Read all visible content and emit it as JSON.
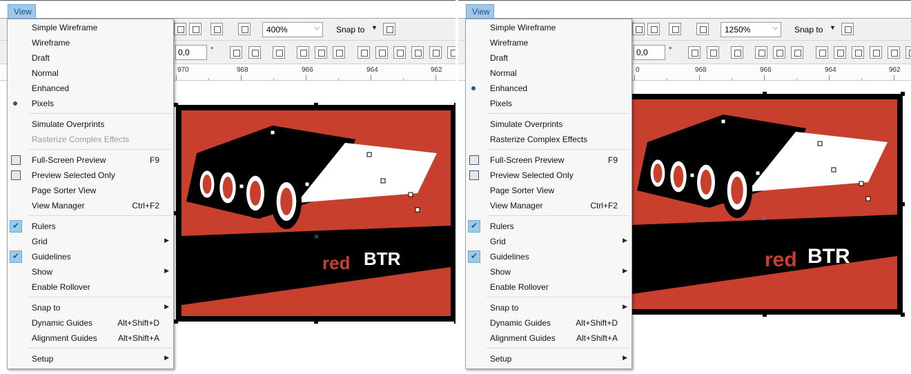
{
  "panes": [
    {
      "menubar": {
        "view_label": "View"
      },
      "toolbar": {
        "zoom": "400%",
        "snap": "Snap to",
        "field_value": "0,0"
      },
      "ruler": {
        "labels": [
          "970",
          "968",
          "966",
          "964",
          "962"
        ]
      },
      "logo": {
        "red": "red",
        "btr": "BTR"
      },
      "menu": {
        "items": [
          {
            "label": "Simple Wireframe",
            "shortcut": "",
            "state": "none",
            "icon": "",
            "enabled": true,
            "submenu": false
          },
          {
            "label": "Wireframe",
            "shortcut": "",
            "state": "none",
            "icon": "",
            "enabled": true,
            "submenu": false
          },
          {
            "label": "Draft",
            "shortcut": "",
            "state": "none",
            "icon": "",
            "enabled": true,
            "submenu": false
          },
          {
            "label": "Normal",
            "shortcut": "",
            "state": "none",
            "icon": "",
            "enabled": true,
            "submenu": false
          },
          {
            "label": "Enhanced",
            "shortcut": "",
            "state": "none",
            "icon": "",
            "enabled": true,
            "submenu": false
          },
          {
            "label": "Pixels",
            "shortcut": "",
            "state": "radio",
            "icon": "",
            "enabled": true,
            "submenu": false
          },
          {
            "label": "Simulate Overprints",
            "shortcut": "",
            "state": "none",
            "icon": "",
            "enabled": true,
            "submenu": false
          },
          {
            "label": "Rasterize Complex Effects",
            "shortcut": "",
            "state": "none",
            "icon": "",
            "enabled": false,
            "submenu": false
          },
          {
            "label": "Full-Screen Preview",
            "shortcut": "F9",
            "state": "none",
            "icon": "fullscreen-icon",
            "enabled": true,
            "submenu": false
          },
          {
            "label": "Preview Selected Only",
            "shortcut": "",
            "state": "none",
            "icon": "preview-selected-icon",
            "enabled": true,
            "submenu": false
          },
          {
            "label": "Page Sorter View",
            "shortcut": "",
            "state": "none",
            "icon": "",
            "enabled": true,
            "submenu": false
          },
          {
            "label": "View Manager",
            "shortcut": "Ctrl+F2",
            "state": "none",
            "icon": "",
            "enabled": true,
            "submenu": false
          },
          {
            "label": "Rulers",
            "shortcut": "",
            "state": "check",
            "icon": "",
            "enabled": true,
            "submenu": false
          },
          {
            "label": "Grid",
            "shortcut": "",
            "state": "none",
            "icon": "",
            "enabled": true,
            "submenu": true
          },
          {
            "label": "Guidelines",
            "shortcut": "",
            "state": "check",
            "icon": "",
            "enabled": true,
            "submenu": false
          },
          {
            "label": "Show",
            "shortcut": "",
            "state": "none",
            "icon": "",
            "enabled": true,
            "submenu": true
          },
          {
            "label": "Enable Rollover",
            "shortcut": "",
            "state": "none",
            "icon": "",
            "enabled": true,
            "submenu": false
          },
          {
            "label": "Snap to",
            "shortcut": "",
            "state": "none",
            "icon": "",
            "enabled": true,
            "submenu": true
          },
          {
            "label": "Dynamic Guides",
            "shortcut": "Alt+Shift+D",
            "state": "none",
            "icon": "",
            "enabled": true,
            "submenu": false
          },
          {
            "label": "Alignment Guides",
            "shortcut": "Alt+Shift+A",
            "state": "none",
            "icon": "",
            "enabled": true,
            "submenu": false
          },
          {
            "label": "Setup",
            "shortcut": "",
            "state": "none",
            "icon": "",
            "enabled": true,
            "submenu": true
          }
        ]
      }
    },
    {
      "menubar": {
        "view_label": "View"
      },
      "toolbar": {
        "zoom": "1250%",
        "snap": "Snap to",
        "field_value": "0,0"
      },
      "ruler": {
        "labels": [
          "0",
          "968",
          "966",
          "964",
          "962"
        ]
      },
      "logo": {
        "red": "red",
        "btr": "BTR"
      },
      "menu": {
        "items": [
          {
            "label": "Simple Wireframe",
            "shortcut": "",
            "state": "none",
            "icon": "",
            "enabled": true,
            "submenu": false
          },
          {
            "label": "Wireframe",
            "shortcut": "",
            "state": "none",
            "icon": "",
            "enabled": true,
            "submenu": false
          },
          {
            "label": "Draft",
            "shortcut": "",
            "state": "none",
            "icon": "",
            "enabled": true,
            "submenu": false
          },
          {
            "label": "Normal",
            "shortcut": "",
            "state": "none",
            "icon": "",
            "enabled": true,
            "submenu": false
          },
          {
            "label": "Enhanced",
            "shortcut": "",
            "state": "radio",
            "icon": "",
            "enabled": true,
            "submenu": false
          },
          {
            "label": "Pixels",
            "shortcut": "",
            "state": "none",
            "icon": "",
            "enabled": true,
            "submenu": false
          },
          {
            "label": "Simulate Overprints",
            "shortcut": "",
            "state": "none",
            "icon": "",
            "enabled": true,
            "submenu": false
          },
          {
            "label": "Rasterize Complex Effects",
            "shortcut": "",
            "state": "none",
            "icon": "",
            "enabled": true,
            "submenu": false
          },
          {
            "label": "Full-Screen Preview",
            "shortcut": "F9",
            "state": "none",
            "icon": "fullscreen-icon",
            "enabled": true,
            "submenu": false
          },
          {
            "label": "Preview Selected Only",
            "shortcut": "",
            "state": "none",
            "icon": "preview-selected-icon",
            "enabled": true,
            "submenu": false
          },
          {
            "label": "Page Sorter View",
            "shortcut": "",
            "state": "none",
            "icon": "",
            "enabled": true,
            "submenu": false
          },
          {
            "label": "View Manager",
            "shortcut": "Ctrl+F2",
            "state": "none",
            "icon": "",
            "enabled": true,
            "submenu": false
          },
          {
            "label": "Rulers",
            "shortcut": "",
            "state": "check",
            "icon": "",
            "enabled": true,
            "submenu": false
          },
          {
            "label": "Grid",
            "shortcut": "",
            "state": "none",
            "icon": "",
            "enabled": true,
            "submenu": true
          },
          {
            "label": "Guidelines",
            "shortcut": "",
            "state": "check",
            "icon": "",
            "enabled": true,
            "submenu": false
          },
          {
            "label": "Show",
            "shortcut": "",
            "state": "none",
            "icon": "",
            "enabled": true,
            "submenu": true
          },
          {
            "label": "Enable Rollover",
            "shortcut": "",
            "state": "none",
            "icon": "",
            "enabled": true,
            "submenu": false
          },
          {
            "label": "Snap to",
            "shortcut": "",
            "state": "none",
            "icon": "",
            "enabled": true,
            "submenu": true
          },
          {
            "label": "Dynamic Guides",
            "shortcut": "Alt+Shift+D",
            "state": "none",
            "icon": "",
            "enabled": true,
            "submenu": false
          },
          {
            "label": "Alignment Guides",
            "shortcut": "Alt+Shift+A",
            "state": "none",
            "icon": "",
            "enabled": true,
            "submenu": false
          },
          {
            "label": "Setup",
            "shortcut": "",
            "state": "none",
            "icon": "",
            "enabled": true,
            "submenu": true
          }
        ]
      }
    }
  ],
  "colors": {
    "logo_red": "#c8402d",
    "logo_black": "#000000",
    "menu_highlight": "#9fc8ea",
    "check_bg": "#9ccae9"
  }
}
